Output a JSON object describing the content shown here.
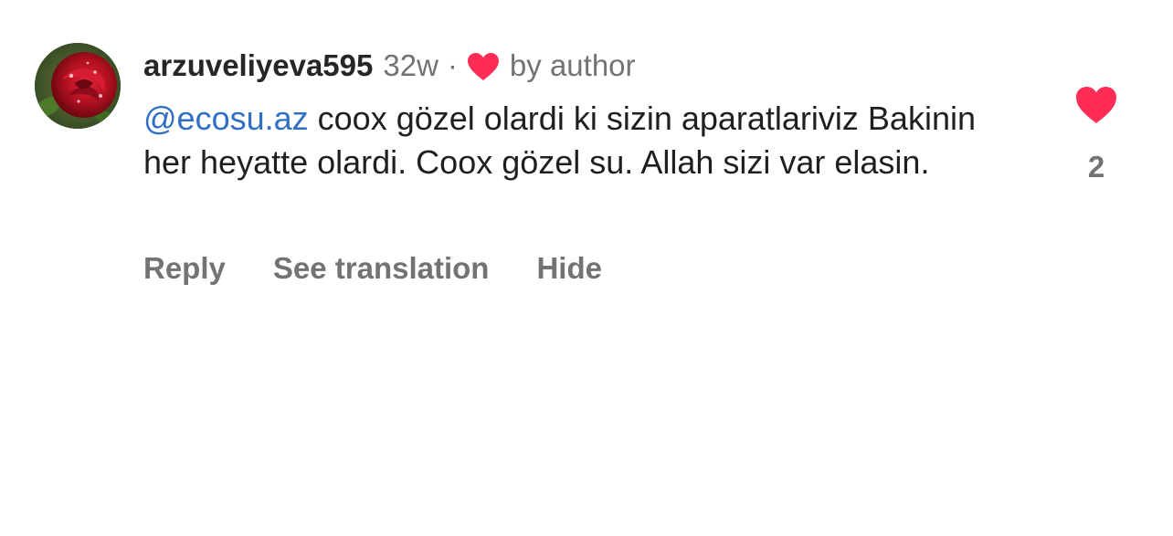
{
  "comment": {
    "username": "arzuveliyeva595",
    "time": "32w",
    "separator": "·",
    "liked_by_author_label": "by author",
    "mention": "@ecosu.az",
    "text": "coox gözel olardi ki sizin aparatlariviz Bakinin her heyatte olardi. Coox gözel su. Allah sizi var elasin.",
    "like_count": "2",
    "liked_icon": "heart-filled-icon",
    "avatar_icon": "red-rose-avatar"
  },
  "actions": {
    "reply_label": "Reply",
    "translate_label": "See translation",
    "hide_label": "Hide"
  },
  "colors": {
    "heart": "#ff2d55",
    "mention": "#2f6fc4",
    "secondary_text": "#737373",
    "primary_text": "#262626"
  }
}
